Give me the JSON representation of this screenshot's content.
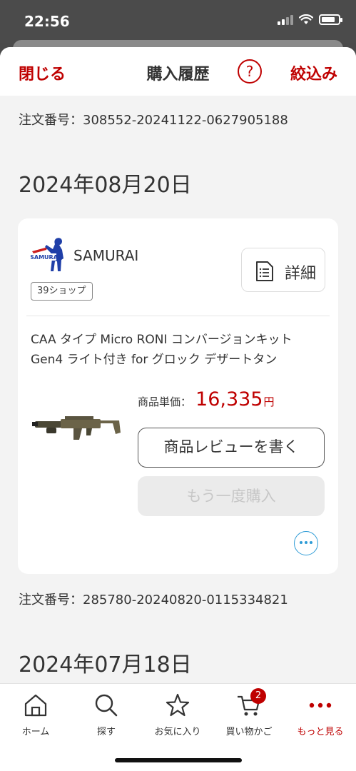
{
  "status": {
    "time": "22:56"
  },
  "header": {
    "close": "閉じる",
    "title": "購入履歴",
    "help": "?",
    "filter": "絞込み"
  },
  "orders": {
    "prev_order_number": "注文番号：308552-20241122-0627905188",
    "date1": "2024年08月20日",
    "card": {
      "shop_name": "SAMURAI",
      "logo_text": "SAMURAI",
      "shop_badge": "39ショップ",
      "detail_label": "詳細",
      "product_name": "CAA タイプ Micro RONI コンバージョンキット Gen4 ライト付き for グロック デザートタン",
      "price_label": "商品単価：",
      "price_value": "16,335",
      "price_unit": "円",
      "review_button": "商品レビューを書く",
      "rebuy_button": "もう一度購入"
    },
    "order_number": "注文番号：285780-20240820-0115334821",
    "date2": "2024年07月18日"
  },
  "tabbar": {
    "home": "ホーム",
    "search": "探す",
    "favorites": "お気に入り",
    "cart": "買い物かご",
    "cart_count": "2",
    "more": "もっと見る"
  },
  "colors": {
    "accent": "#bf0000",
    "link_blue": "#2d9bd6",
    "background": "#f3f3f3"
  }
}
